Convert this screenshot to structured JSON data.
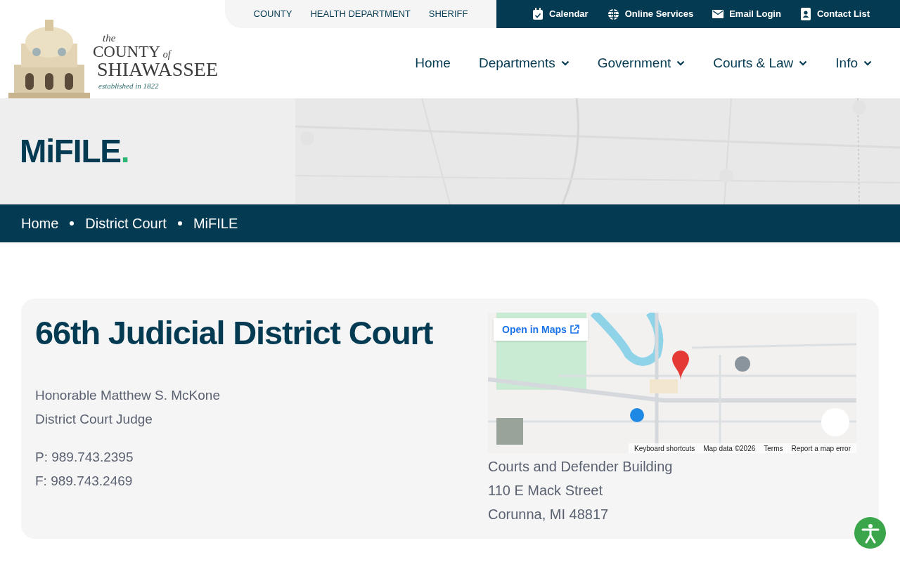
{
  "top_links": [
    {
      "label": "COUNTY"
    },
    {
      "label": "HEALTH DEPARTMENT"
    },
    {
      "label": "SHERIFF"
    }
  ],
  "utility_links": [
    {
      "label": "Calendar",
      "kind": "calendar"
    },
    {
      "label": "Online Services",
      "kind": "globe"
    },
    {
      "label": "Email Login",
      "kind": "mail"
    },
    {
      "label": "Contact List",
      "kind": "contact"
    }
  ],
  "logo": {
    "the": "the",
    "county": "COUNTY",
    "of": "of",
    "name": "SHIAWASSEE",
    "tagline": "established in 1822"
  },
  "main_nav": [
    {
      "label": "Home",
      "dropdown": false
    },
    {
      "label": "Departments",
      "dropdown": true
    },
    {
      "label": "Government",
      "dropdown": true
    },
    {
      "label": "Courts & Law",
      "dropdown": true
    },
    {
      "label": "Info",
      "dropdown": true
    }
  ],
  "hero": {
    "title": "MiFILE",
    "dot": "."
  },
  "breadcrumb": [
    {
      "label": "Home"
    },
    {
      "label": "District Court"
    },
    {
      "label": "MiFILE"
    }
  ],
  "court": {
    "title": "66th Judicial District Court",
    "judge": "Honorable Matthew S. McKone",
    "role": "District Court Judge",
    "phone": "P: 989.743.2395",
    "fax": "F: 989.743.2469"
  },
  "map": {
    "open_label": "Open in Maps",
    "footer": [
      "Keyboard shortcuts",
      "Map data ©2026",
      "Terms",
      "Report a map error"
    ]
  },
  "address": [
    "Courts and Defender Building",
    "110 E Mack Street",
    "Corunna, MI 48817"
  ]
}
